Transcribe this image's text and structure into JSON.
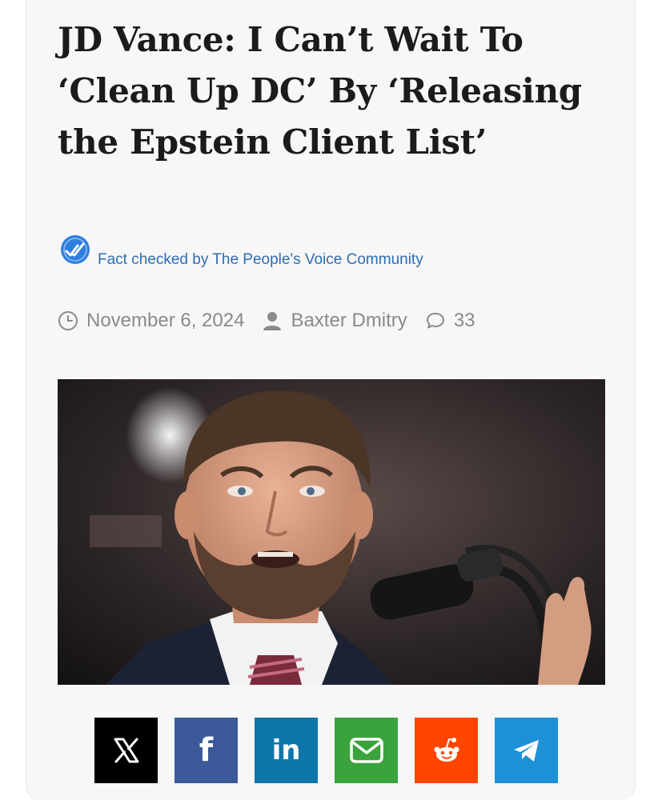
{
  "article": {
    "headline": "JD Vance: I Can’t Wait To ‘Clean Up DC’ By ‘Releasing the Epstein Client List’",
    "fact_check": "Fact checked by The People's Voice Community",
    "date": "November 6, 2024",
    "author": "Baxter Dmitry",
    "comments": "33"
  },
  "icons": {
    "fact_check": "check-badge-icon",
    "date": "clock-icon",
    "author": "user-icon",
    "comments": "comment-bubble-icon"
  },
  "share": [
    {
      "network": "X",
      "label": "𝕏",
      "color": "#000000"
    },
    {
      "network": "Facebook",
      "label": "f",
      "color": "#3b5998"
    },
    {
      "network": "LinkedIn",
      "label": "in",
      "color": "#0e76a8"
    },
    {
      "network": "Email",
      "label": "",
      "color": "#3aa33b"
    },
    {
      "network": "Reddit",
      "label": "",
      "color": "#ff4500"
    },
    {
      "network": "Telegram",
      "label": "",
      "color": "#1e90d6"
    }
  ],
  "colors": {
    "headline": "#1b1b1b",
    "fact_check_text": "#2d6db3",
    "meta_text": "#8a8a8a"
  }
}
